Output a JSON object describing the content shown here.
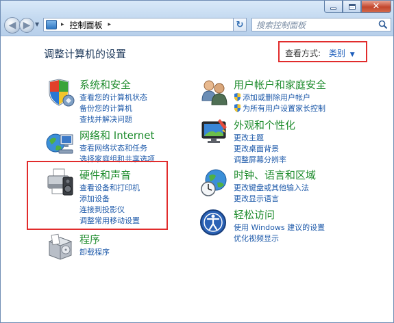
{
  "window": {
    "minimize_icon": "minimize-icon",
    "maximize_icon": "maximize-icon",
    "close_icon": "close-icon",
    "close_glyph": "✕"
  },
  "nav": {
    "back_glyph": "◀",
    "forward_glyph": "▶",
    "address_text": "控制面板",
    "address_sep": "▸",
    "refresh_glyph": "↻",
    "search_placeholder": "搜索控制面板"
  },
  "header": {
    "title": "调整计算机的设置",
    "view_by_label": "查看方式:",
    "view_by_value": "类别",
    "view_by_arrow": "▼"
  },
  "categories_left": [
    {
      "title": "系统和安全",
      "icon": "shield-flag-icon",
      "links": [
        "查看您的计算机状态",
        "备份您的计算机",
        "查找并解决问题"
      ]
    },
    {
      "title": "网络和 Internet",
      "icon": "network-globe-icon",
      "links": [
        "查看网络状态和任务",
        "选择家庭组和共享选项"
      ]
    },
    {
      "title": "硬件和声音",
      "icon": "printer-speaker-icon",
      "links": [
        "查看设备和打印机",
        "添加设备",
        "连接到投影仪",
        "调整常用移动设置"
      ]
    },
    {
      "title": "程序",
      "icon": "programs-box-icon",
      "links": [
        "卸载程序"
      ]
    }
  ],
  "categories_right": [
    {
      "title": "用户帐户和家庭安全",
      "icon": "users-icon",
      "links": [
        "添加或删除用户帐户",
        "为所有用户设置家长控制"
      ]
    },
    {
      "title": "外观和个性化",
      "icon": "monitor-paint-icon",
      "links": [
        "更改主题",
        "更改桌面背景",
        "调整屏幕分辨率"
      ]
    },
    {
      "title": "时钟、语言和区域",
      "icon": "clock-globe-icon",
      "links": [
        "更改键盘或其他输入法",
        "更改显示语言"
      ]
    },
    {
      "title": "轻松访问",
      "icon": "ease-of-access-icon",
      "links": [
        "使用 Windows 建议的设置",
        "优化视频显示"
      ]
    }
  ],
  "colors": {
    "link": "#1e5aaa",
    "category_title": "#1f8c2e",
    "highlight_box": "#e12c2c"
  }
}
